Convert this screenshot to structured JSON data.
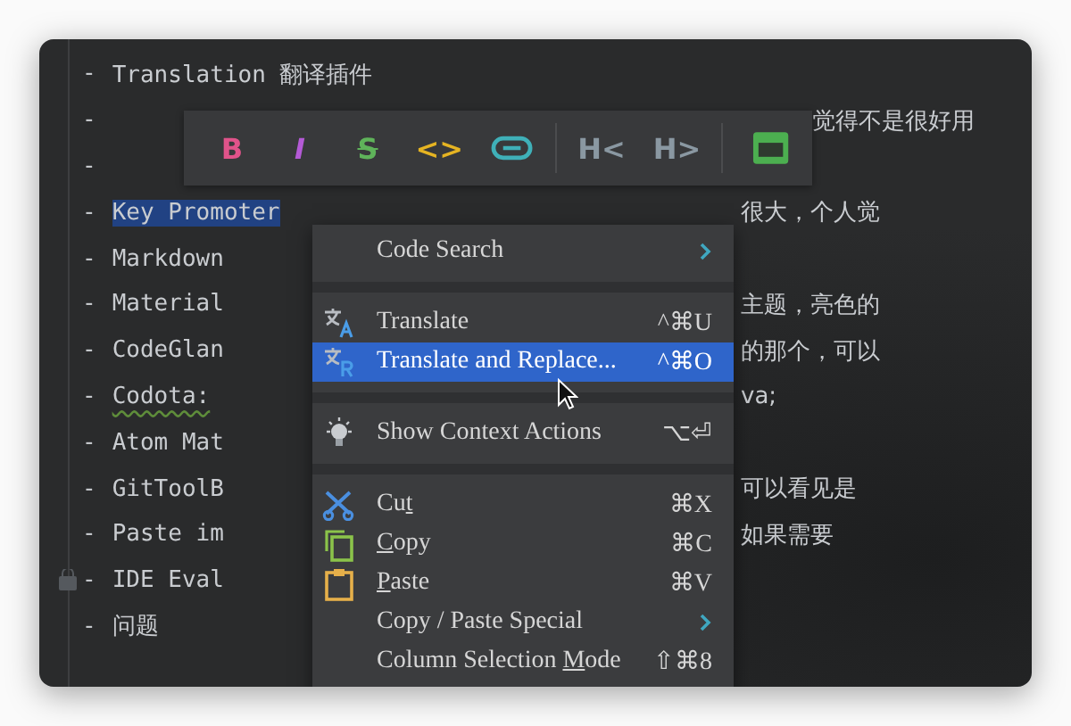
{
  "editor": {
    "outline": [
      {
        "children": [
          {
            "marker": "-",
            "text": "Translation 翻译插件"
          },
          {
            "marker": "-",
            "right": "觉得不是很好用",
            "kind": "under_toolbar"
          },
          {
            "marker": "-"
          },
          {
            "marker": "-",
            "text": "Key Promoter",
            "selected": true,
            "right": "很大，个人觉",
            "kind": "plain"
          },
          {
            "marker": "-",
            "text": "Markdown"
          },
          {
            "marker": "-",
            "text": "Material",
            "right": "主题，亮色的",
            "kind": "plain"
          },
          {
            "marker": "-",
            "text": "CodeGlan",
            "right": "的那个，可以",
            "kind": "plain"
          },
          {
            "marker": "-",
            "text": "Codota:",
            "spellcheck": true,
            "right": "va;",
            "kind": "plain"
          },
          {
            "marker": "-",
            "text": "Atom Mat"
          },
          {
            "marker": "-",
            "text": "GitToolB",
            "right": "可以看见是",
            "kind": "plain"
          },
          {
            "marker": "-",
            "text": "Paste im",
            "right": "如果需要",
            "kind": "plain"
          },
          {
            "marker": "-",
            "text": "IDE Eval"
          }
        ]
      },
      {
        "marker": "-",
        "text": "问题"
      }
    ]
  },
  "format_toolbar": {
    "buttons": [
      {
        "kind": "text",
        "label": "B",
        "color": "#e0538a"
      },
      {
        "kind": "italic",
        "label": "I",
        "color": "#b45ad6"
      },
      {
        "kind": "strike",
        "label": "S",
        "color": "#5fb35a"
      },
      {
        "kind": "text",
        "label": "<>",
        "color": "#e6b422"
      },
      {
        "kind": "link",
        "color": "#3fb0b8"
      },
      {
        "kind": "separator"
      },
      {
        "kind": "text",
        "label": "H<",
        "color": "#8a98a2"
      },
      {
        "kind": "text",
        "label": "H>",
        "color": "#8a98a2"
      },
      {
        "kind": "separator"
      },
      {
        "kind": "table",
        "color": "#4caf50"
      }
    ]
  },
  "context_menu": {
    "items": [
      {
        "kind": "plain",
        "label": "Code Search",
        "submenu": true,
        "selected": false
      },
      {
        "kind": "separator"
      },
      {
        "kind": "translate",
        "label": "Translate",
        "shortcut": "^⌘U",
        "selected": false
      },
      {
        "kind": "replace",
        "label": "Translate and Replace...",
        "shortcut": "^⌘O",
        "selected": true
      },
      {
        "kind": "separator"
      },
      {
        "kind": "bulb",
        "label": "Show Context Actions",
        "shortcut": "⌥⏎",
        "selected": false
      },
      {
        "kind": "separator"
      },
      {
        "kind": "scissors",
        "label": "Cu",
        "mnemonic": "t",
        "shortcut": "⌘X",
        "selected": false
      },
      {
        "kind": "copy",
        "mnemonic": "C",
        "rest": "opy",
        "shortcut": "⌘C",
        "selected": false
      },
      {
        "kind": "paste",
        "mnemonic": "P",
        "rest": "aste",
        "shortcut": "⌘V",
        "selected": false
      },
      {
        "kind": "plain",
        "label": "Copy / Paste Special",
        "submenu": true,
        "selected": false
      },
      {
        "kind": "plain",
        "label": "Column Selection ",
        "mnemonic": "M",
        "rest": "ode",
        "shortcut": "⇧⌘8",
        "selected": false
      }
    ]
  }
}
